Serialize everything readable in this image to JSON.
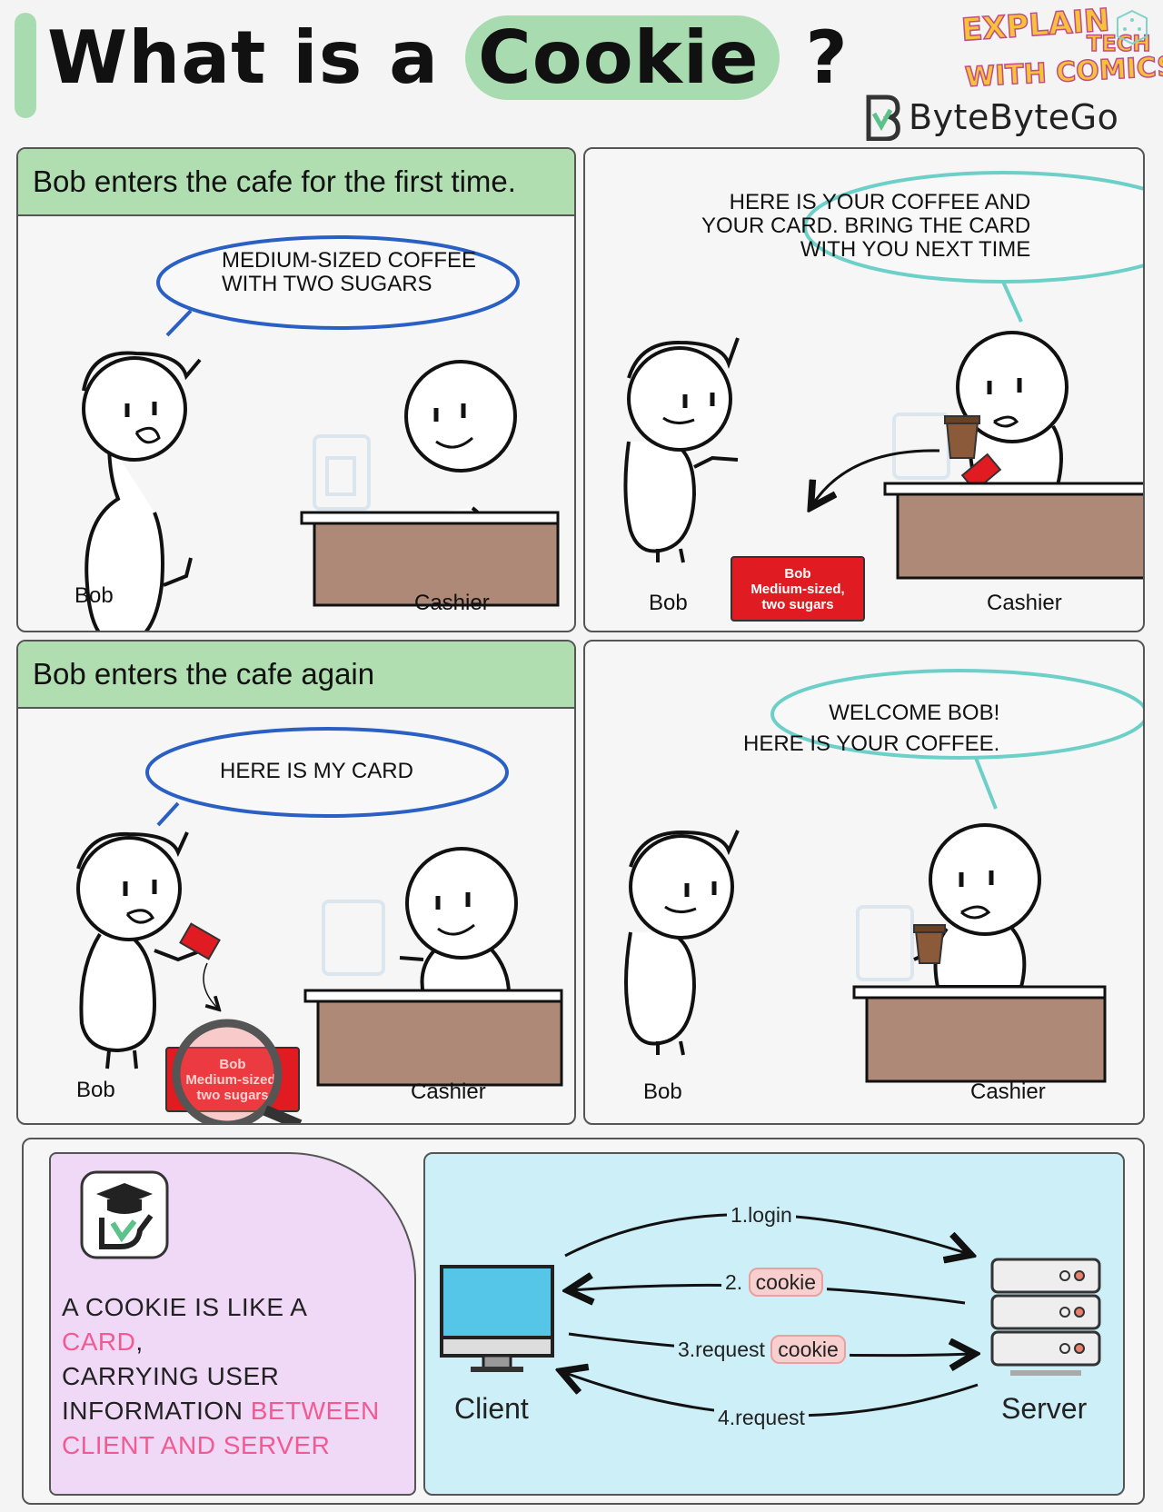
{
  "title": {
    "prefix": "What is a",
    "highlight": "Cookie",
    "suffix": "?"
  },
  "branding": {
    "series_line1": "EXPLAIN",
    "series_line2": "TECH",
    "series_line3": "WITH COMICS",
    "company": "ByteByteGo"
  },
  "panel1": {
    "header": "Bob enters the cafe for the first time.",
    "bubble": "MEDIUM-SIZED COFFEE\nWITH TWO SUGARS",
    "left_label": "Bob",
    "right_label": "Cashier"
  },
  "panel2": {
    "bubble": "HERE IS YOUR COFFEE AND\nYOUR CARD. BRING THE CARD\nWITH YOU NEXT TIME",
    "card_name": "Bob",
    "card_line2": "Medium-sized,",
    "card_line3": "two sugars",
    "left_label": "Bob",
    "right_label": "Cashier"
  },
  "panel3": {
    "header": "Bob enters the cafe again",
    "bubble": "HERE IS MY CARD",
    "card_name": "Bob",
    "card_line2": "Medium-sized,",
    "card_line3": "two sugars",
    "left_label": "Bob",
    "right_label": "Cashier"
  },
  "panel4": {
    "bubble": "WELCOME BOB!\nHERE IS YOUR COFFEE.",
    "left_label": "Bob",
    "right_label": "Cashier"
  },
  "summary": {
    "line1": "A COOKIE IS LIKE A",
    "highlight1": "CARD",
    "line2_end": ",",
    "line3": "CARRYING USER",
    "line4": "INFORMATION",
    "highlight2": "BETWEEN",
    "highlight3": "CLIENT AND SERVER"
  },
  "diagram": {
    "client": "Client",
    "server": "Server",
    "step1": "1.login",
    "step2": "2.",
    "step2_pill": "cookie",
    "step3": "3.request",
    "step3_pill": "cookie",
    "step4": "4.request"
  },
  "colors": {
    "green": "#a8dcb0",
    "red_card": "#e01b22",
    "pink": "#f15b92",
    "purple": "#f0d8f7",
    "light_blue": "#cdeff8",
    "desk": "#ae8977"
  }
}
